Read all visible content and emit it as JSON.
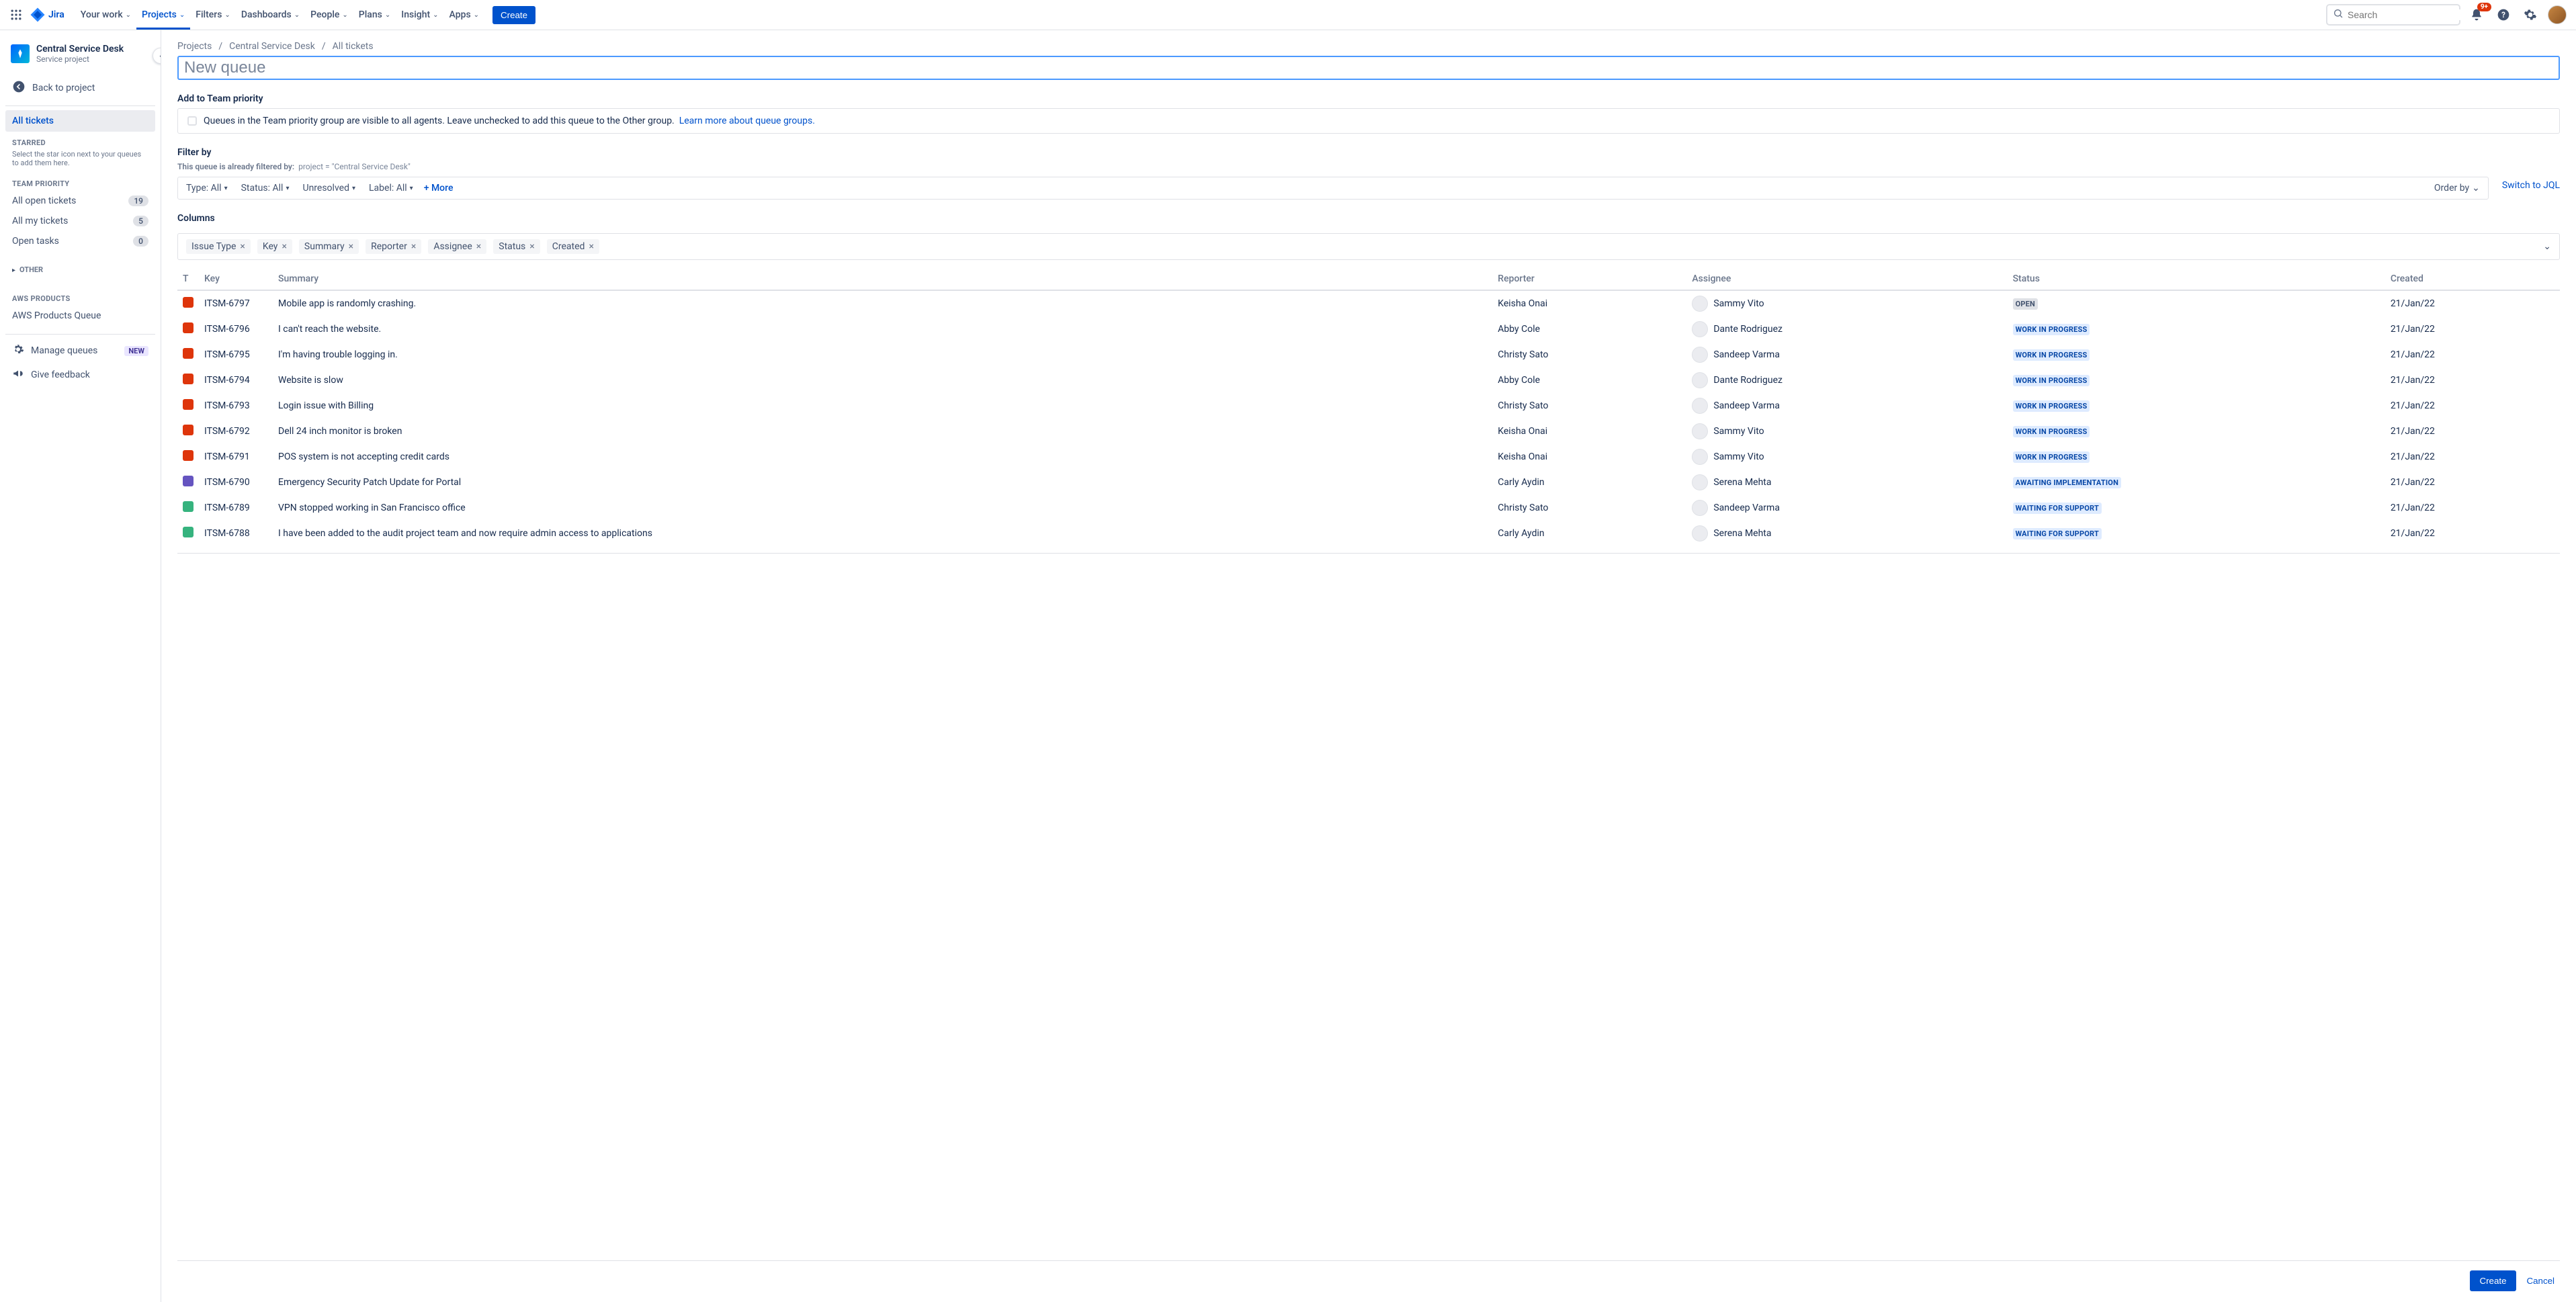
{
  "nav": {
    "product": "Jira",
    "items": [
      "Your work",
      "Projects",
      "Filters",
      "Dashboards",
      "People",
      "Plans",
      "Insight",
      "Apps"
    ],
    "activeIndex": 1,
    "create": "Create",
    "search_placeholder": "Search",
    "notif_badge": "9+"
  },
  "sidebar": {
    "project_name": "Central Service Desk",
    "project_type": "Service project",
    "back": "Back to project",
    "all_tickets": "All tickets",
    "starred_hd": "STARRED",
    "starred_hint": "Select the star icon next to your queues to add them here.",
    "team_priority_hd": "TEAM PRIORITY",
    "team_priority": [
      {
        "label": "All open tickets",
        "count": "19"
      },
      {
        "label": "All my tickets",
        "count": "5"
      },
      {
        "label": "Open tasks",
        "count": "0"
      }
    ],
    "other_hd": "OTHER",
    "aws_hd": "AWS PRODUCTS",
    "aws_item": "AWS Products Queue",
    "manage": "Manage queues",
    "manage_new": "NEW",
    "feedback": "Give feedback"
  },
  "breadcrumb": [
    "Projects",
    "Central Service Desk",
    "All tickets"
  ],
  "queue_placeholder": "New queue",
  "team_prio": {
    "hd": "Add to Team priority",
    "text": "Queues in the Team priority group are visible to all agents. Leave unchecked to add this queue to the Other group.",
    "link": "Learn more about queue groups."
  },
  "filter": {
    "hd": "Filter by",
    "sub": "This queue is already filtered by:",
    "pill": "project = \"Central Service Desk\"",
    "chips": [
      "Type: All",
      "Status: All",
      "Unresolved",
      "Label: All"
    ],
    "more": "+ More",
    "orderby": "Order by",
    "switch": "Switch to JQL"
  },
  "columns": {
    "hd": "Columns",
    "tags": [
      "Issue Type",
      "Key",
      "Summary",
      "Reporter",
      "Assignee",
      "Status",
      "Created"
    ]
  },
  "headers": [
    "T",
    "Key",
    "Summary",
    "Reporter",
    "Assignee",
    "Status",
    "Created"
  ],
  "rows": [
    {
      "type": "red",
      "key": "ITSM-6797",
      "summary": "Mobile app is randomly crashing.",
      "reporter": "Keisha Onai",
      "assignee": "Sammy Vito",
      "status": "OPEN",
      "status_cls": "loz-open",
      "created": "21/Jan/22"
    },
    {
      "type": "red",
      "key": "ITSM-6796",
      "summary": "I can't reach the website.",
      "reporter": "Abby Cole",
      "assignee": "Dante Rodriguez",
      "status": "WORK IN PROGRESS",
      "status_cls": "loz-prog",
      "created": "21/Jan/22"
    },
    {
      "type": "red",
      "key": "ITSM-6795",
      "summary": "I'm having trouble logging in.",
      "reporter": "Christy Sato",
      "assignee": "Sandeep Varma",
      "status": "WORK IN PROGRESS",
      "status_cls": "loz-prog",
      "created": "21/Jan/22"
    },
    {
      "type": "red",
      "key": "ITSM-6794",
      "summary": "Website is slow",
      "reporter": "Abby Cole",
      "assignee": "Dante Rodriguez",
      "status": "WORK IN PROGRESS",
      "status_cls": "loz-prog",
      "created": "21/Jan/22"
    },
    {
      "type": "red",
      "key": "ITSM-6793",
      "summary": "Login issue with Billing",
      "reporter": "Christy Sato",
      "assignee": "Sandeep Varma",
      "status": "WORK IN PROGRESS",
      "status_cls": "loz-prog",
      "created": "21/Jan/22"
    },
    {
      "type": "red",
      "key": "ITSM-6792",
      "summary": "Dell 24 inch monitor is broken",
      "reporter": "Keisha Onai",
      "assignee": "Sammy Vito",
      "status": "WORK IN PROGRESS",
      "status_cls": "loz-prog",
      "created": "21/Jan/22"
    },
    {
      "type": "red",
      "key": "ITSM-6791",
      "summary": "POS system is not accepting credit cards",
      "reporter": "Keisha Onai",
      "assignee": "Sammy Vito",
      "status": "WORK IN PROGRESS",
      "status_cls": "loz-prog",
      "created": "21/Jan/22"
    },
    {
      "type": "purple",
      "key": "ITSM-6790",
      "summary": "Emergency Security Patch Update for Portal",
      "reporter": "Carly Aydin",
      "assignee": "Serena Mehta",
      "status": "AWAITING IMPLEMENTATION",
      "status_cls": "loz-await",
      "created": "21/Jan/22"
    },
    {
      "type": "green",
      "key": "ITSM-6789",
      "summary": "VPN stopped working in San Francisco office",
      "reporter": "Christy Sato",
      "assignee": "Sandeep Varma",
      "status": "WAITING FOR SUPPORT",
      "status_cls": "loz-wait",
      "created": "21/Jan/22"
    },
    {
      "type": "green",
      "key": "ITSM-6788",
      "summary": "I have been added to the audit project team and now require admin access to applications",
      "reporter": "Carly Aydin",
      "assignee": "Serena Mehta",
      "status": "WAITING FOR SUPPORT",
      "status_cls": "loz-wait",
      "created": "21/Jan/22"
    }
  ],
  "footer": {
    "create": "Create",
    "cancel": "Cancel"
  }
}
